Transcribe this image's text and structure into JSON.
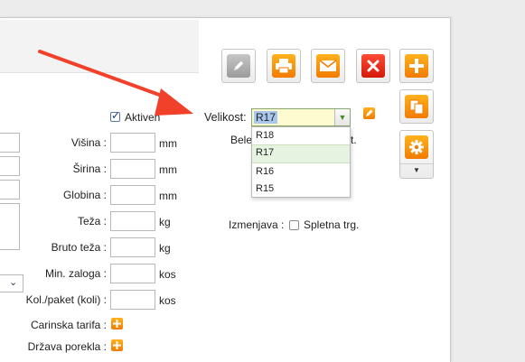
{
  "form": {
    "aktiven_label": "Aktiven",
    "velikost_label": "Velikost:",
    "velikost_value": "R17",
    "velikost_options": [
      "R18",
      "R17",
      "R16",
      "R15"
    ],
    "bele_label": "Bele",
    "bele_suffix": "t.",
    "visina_label": "Višina :",
    "visina_unit": "mm",
    "sirina_label": "Širina :",
    "sirina_unit": "mm",
    "globina_label": "Globina :",
    "globina_unit": "mm",
    "teza_label": "Teža :",
    "teza_unit": "kg",
    "bruto_label": "Bruto teža :",
    "bruto_unit": "kg",
    "zaloga_label": "Min. zaloga :",
    "zaloga_unit": "kos",
    "paket_label": "Kol./paket (koli) :",
    "paket_unit": "kos",
    "carinska_label": "Carinska tarifa :",
    "drzava_label": "Država porekla :",
    "izmenjava_label": "Izmenjava :",
    "spletna_label": "Spletna trg."
  },
  "toolbar": {
    "buttons": [
      "edit-icon",
      "print-icon",
      "mail-icon",
      "delete-icon",
      "add-icon",
      "copy-icon",
      "settings-icon"
    ],
    "colors": {
      "orange": "#f28c0f",
      "red": "#e0271a",
      "grey": "#b0b0b0"
    }
  },
  "annotation": {
    "arrow_color": "#f2412a"
  }
}
